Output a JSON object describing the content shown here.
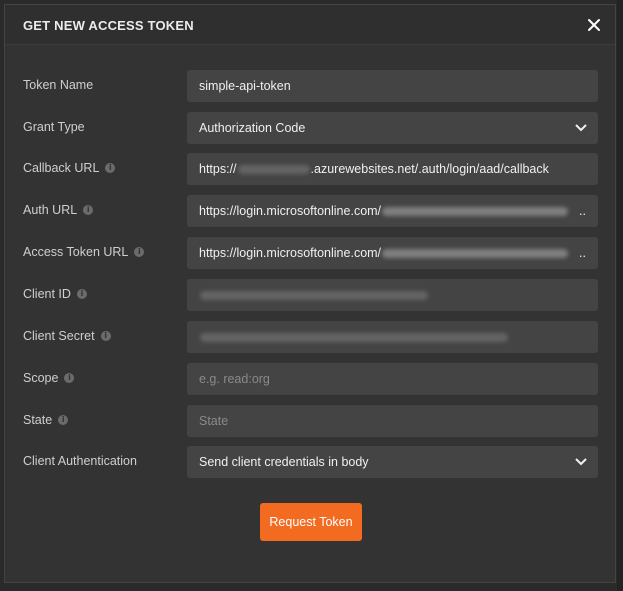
{
  "dialog": {
    "title": "GET NEW ACCESS TOKEN",
    "close_icon": "close-icon"
  },
  "form": {
    "token_name": {
      "label": "Token Name",
      "value": "simple-api-token"
    },
    "grant_type": {
      "label": "Grant Type",
      "value": "Authorization Code"
    },
    "callback_url": {
      "label": "Callback URL",
      "prefix": "https://",
      "suffix": ".azurewebsites.net/.auth/login/aad/callback"
    },
    "auth_url": {
      "label": "Auth URL",
      "prefix": "https://login.microsoftonline.com/",
      "ellipsis": ".."
    },
    "access_token_url": {
      "label": "Access Token URL",
      "prefix": "https://login.microsoftonline.com/",
      "ellipsis": ".."
    },
    "client_id": {
      "label": "Client ID"
    },
    "client_secret": {
      "label": "Client Secret"
    },
    "scope": {
      "label": "Scope",
      "placeholder": "e.g. read:org"
    },
    "state": {
      "label": "State",
      "placeholder": "State"
    },
    "client_authentication": {
      "label": "Client Authentication",
      "value": "Send client credentials in body"
    }
  },
  "actions": {
    "request_token_label": "Request Token"
  },
  "colors": {
    "accent": "#f26b21",
    "modal_bg": "#333333",
    "field_bg": "#444444"
  }
}
